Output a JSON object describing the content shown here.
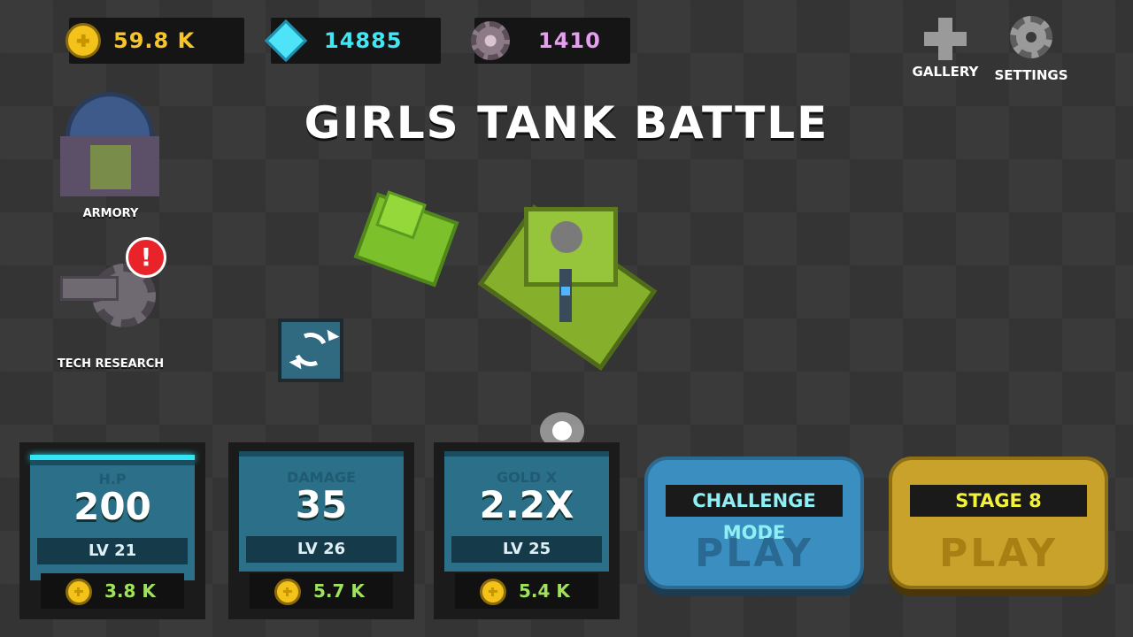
{
  "currencies": {
    "gold": "59.8 K",
    "gems": "14885",
    "parts": "1410"
  },
  "top_right": {
    "gallery_label": "GALLERY",
    "settings_label": "SETTINGS"
  },
  "title": "GIRLS TANK BATTLE",
  "side_menu": {
    "armory_label": "ARMORY",
    "tech_label": "TECH RESEARCH",
    "tech_alert": "!"
  },
  "stats": [
    {
      "label": "H.P",
      "value": "200",
      "level": "LV 21",
      "cost": "3.8 K"
    },
    {
      "label": "DAMAGE",
      "value": "35",
      "level": "LV 26",
      "cost": "5.7 K"
    },
    {
      "label": "GOLD X",
      "value": "2.2X",
      "level": "LV 25",
      "cost": "5.4 K"
    }
  ],
  "challenge": {
    "caption": "CHALLENGE MODE",
    "play": "PLAY"
  },
  "stage": {
    "caption": "STAGE 8",
    "play": "PLAY"
  },
  "colors": {
    "gold_text": "#f7c52a",
    "gem_text": "#41e6f5",
    "parts_text": "#e69ef0",
    "challenge_bg": "#3b8fc0",
    "stage_bg": "#c9a22b",
    "stage_caption": "#f2f23c"
  }
}
